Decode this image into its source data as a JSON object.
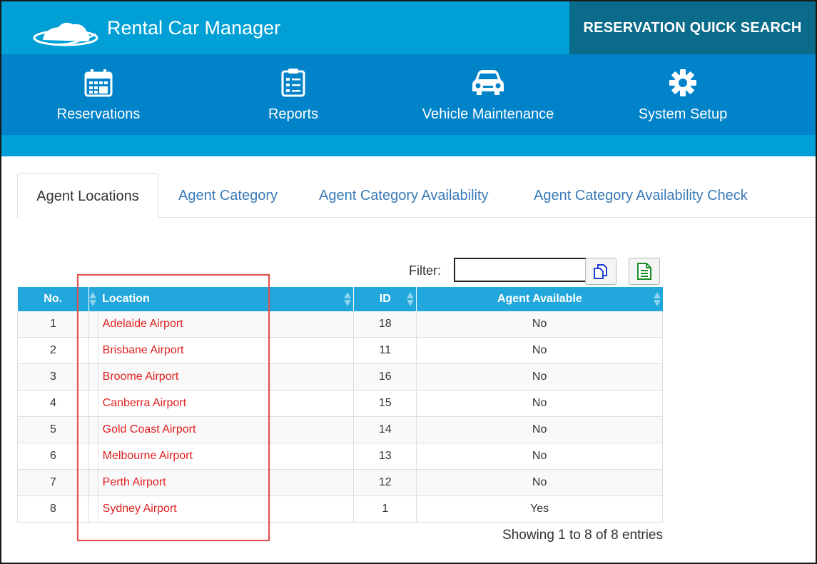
{
  "app": {
    "title": "Rental Car Manager"
  },
  "header": {
    "quick_search": "RESERVATION QUICK SEARCH"
  },
  "nav": [
    {
      "label": "Reservations",
      "icon": "calendar-icon"
    },
    {
      "label": "Reports",
      "icon": "checklist-icon"
    },
    {
      "label": "Vehicle Maintenance",
      "icon": "car-icon"
    },
    {
      "label": "System Setup",
      "icon": "gear-icon"
    }
  ],
  "tabs": [
    {
      "label": "Agent Locations",
      "active": true
    },
    {
      "label": "Agent Category",
      "active": false
    },
    {
      "label": "Agent Category Availability",
      "active": false
    },
    {
      "label": "Agent Category Availability Check",
      "active": false
    }
  ],
  "filter": {
    "label": "Filter:",
    "value": ""
  },
  "table": {
    "columns": [
      "No.",
      "Location",
      "ID",
      "Agent Available"
    ],
    "rows": [
      {
        "no": "1",
        "location": "Adelaide Airport",
        "id": "18",
        "available": "No"
      },
      {
        "no": "2",
        "location": "Brisbane Airport",
        "id": "11",
        "available": "No"
      },
      {
        "no": "3",
        "location": "Broome Airport",
        "id": "16",
        "available": "No"
      },
      {
        "no": "4",
        "location": "Canberra Airport",
        "id": "15",
        "available": "No"
      },
      {
        "no": "5",
        "location": "Gold Coast Airport",
        "id": "14",
        "available": "No"
      },
      {
        "no": "6",
        "location": "Melbourne Airport",
        "id": "13",
        "available": "No"
      },
      {
        "no": "7",
        "location": "Perth Airport",
        "id": "12",
        "available": "No"
      },
      {
        "no": "8",
        "location": "Sydney Airport",
        "id": "1",
        "available": "Yes"
      }
    ]
  },
  "footer": {
    "showing": "Showing 1 to 8 of 8 entries"
  },
  "colors": {
    "topbar": "#00a0d6",
    "navbar": "#0083c8",
    "quick_search_bg": "#0a6b8a",
    "table_header": "#21a7dc",
    "location_link": "#e02020",
    "highlight_box": "#e0514f"
  }
}
